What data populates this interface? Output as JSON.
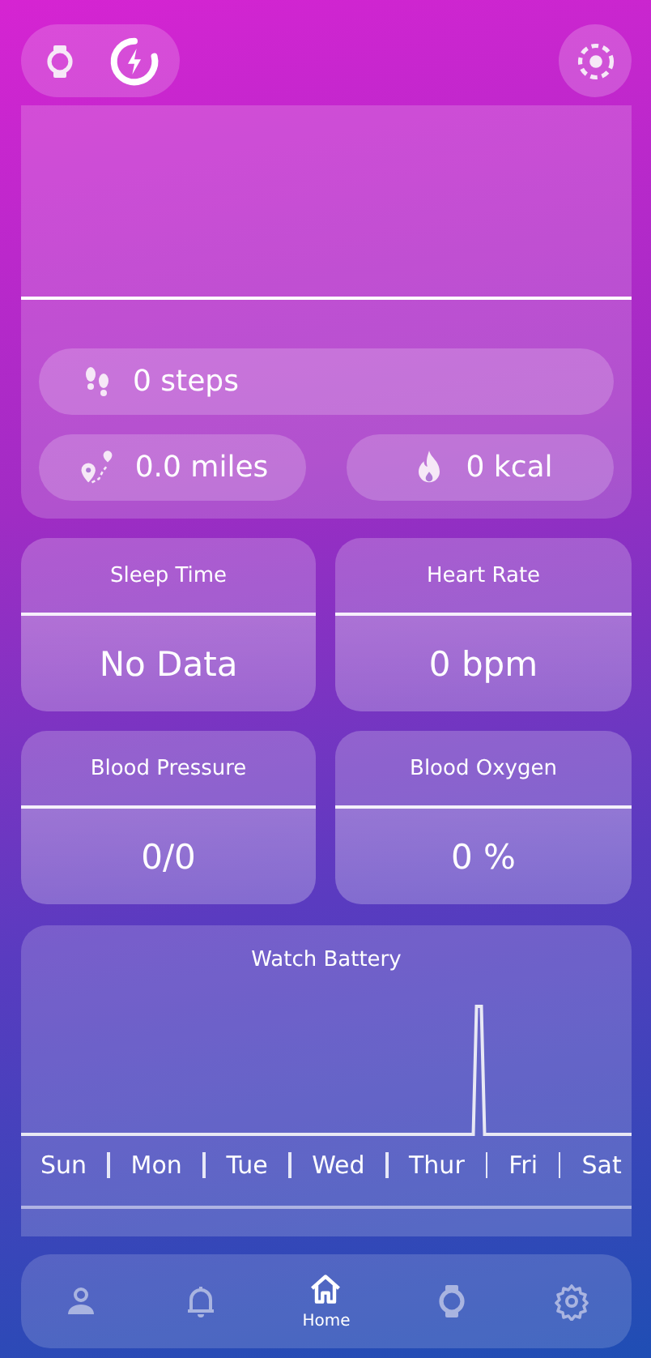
{
  "header": {
    "watch_connected": true,
    "charging": true
  },
  "summary": {
    "steps": "0 steps",
    "distance": "0.0 miles",
    "calories": "0 kcal"
  },
  "metrics": [
    {
      "title": "Sleep Time",
      "value": "No Data"
    },
    {
      "title": "Heart Rate",
      "value": "0 bpm"
    },
    {
      "title": "Blood Pressure",
      "value": "0/0"
    },
    {
      "title": "Blood Oxygen",
      "value": "0 %"
    }
  ],
  "battery": {
    "title": "Watch Battery",
    "days": [
      "Sun",
      "Mon",
      "Tue",
      "Wed",
      "Thur",
      "Fri",
      "Sat"
    ]
  },
  "nav": [
    {
      "kind": "profile",
      "selected": false
    },
    {
      "kind": "alerts",
      "selected": false
    },
    {
      "kind": "home",
      "selected": true,
      "label": "Home"
    },
    {
      "kind": "watch",
      "selected": false
    },
    {
      "kind": "settings",
      "selected": false
    }
  ]
}
